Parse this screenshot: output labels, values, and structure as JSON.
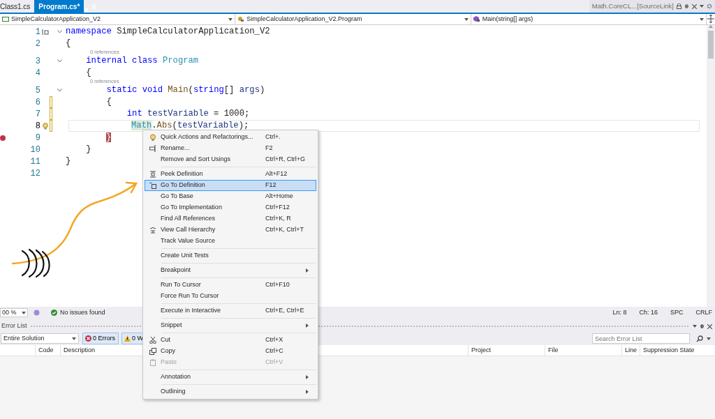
{
  "tabs": [
    {
      "label": "Class1.cs",
      "selected": false
    },
    {
      "label": "Program.cs*",
      "selected": true
    }
  ],
  "preview_tab": {
    "label": "Math.CoreCL...[SourceLink]"
  },
  "navigation": {
    "project": "SimpleCalculatorApplication_V2",
    "type": "SimpleCalculatorApplication_V2.Program",
    "member": "Main(string[] args)"
  },
  "code": {
    "lines": [
      {
        "number": "1",
        "collapsible": true,
        "changed": false,
        "breakpoint": false,
        "current": false,
        "lightbulb": false,
        "tokens": [
          {
            "text": "namespace",
            "kind": "keyword"
          },
          {
            "text": " SimpleCalculatorApplication_V2",
            "kind": "plain"
          }
        ]
      },
      {
        "number": "2",
        "collapsible": false,
        "changed": false,
        "breakpoint": false,
        "current": false,
        "lightbulb": false,
        "tokens": [
          {
            "text": "{",
            "kind": "plain"
          }
        ]
      },
      {
        "number": "3",
        "collapsible": true,
        "changed": false,
        "breakpoint": false,
        "current": false,
        "lightbulb": false,
        "codelens": "0 references",
        "tokens": [
          {
            "text": "    internal class",
            "kind": "keyword"
          },
          {
            "text": " Program",
            "kind": "type"
          }
        ]
      },
      {
        "number": "4",
        "collapsible": false,
        "changed": false,
        "breakpoint": false,
        "current": false,
        "lightbulb": false,
        "tokens": [
          {
            "text": "    {",
            "kind": "plain"
          }
        ]
      },
      {
        "number": "5",
        "collapsible": true,
        "changed": false,
        "breakpoint": false,
        "current": false,
        "lightbulb": false,
        "codelens": "0 references",
        "tokens": [
          {
            "text": "        static void",
            "kind": "keyword"
          },
          {
            "text": " Main",
            "kind": "method"
          },
          {
            "text": "(",
            "kind": "plain"
          },
          {
            "text": "string",
            "kind": "keyword"
          },
          {
            "text": "[] ",
            "kind": "plain"
          },
          {
            "text": "args",
            "kind": "variable"
          },
          {
            "text": ")",
            "kind": "plain"
          }
        ]
      },
      {
        "number": "6",
        "collapsible": false,
        "changed": true,
        "breakpoint": false,
        "current": false,
        "lightbulb": false,
        "tokens": [
          {
            "text": "        {",
            "kind": "plain"
          }
        ]
      },
      {
        "number": "7",
        "collapsible": false,
        "changed": true,
        "breakpoint": false,
        "current": false,
        "lightbulb": false,
        "tokens": [
          {
            "text": "            int",
            "kind": "keyword"
          },
          {
            "text": " testVariable",
            "kind": "variable"
          },
          {
            "text": " = 1000;",
            "kind": "plain"
          }
        ]
      },
      {
        "number": "8",
        "collapsible": false,
        "changed": true,
        "breakpoint": false,
        "current": true,
        "lightbulb": true,
        "tokens": [
          {
            "text": "Math",
            "kind": "reference"
          },
          {
            "text": ".",
            "kind": "plain"
          },
          {
            "text": "Abs",
            "kind": "method"
          },
          {
            "text": "(",
            "kind": "plain"
          },
          {
            "text": "testVariable",
            "kind": "variable"
          },
          {
            "text": ");",
            "kind": "plain"
          }
        ]
      },
      {
        "number": "9",
        "collapsible": false,
        "changed": false,
        "breakpoint": true,
        "current": false,
        "lightbulb": false,
        "tokens": [
          {
            "text": "}",
            "kind": "brace-stop"
          }
        ]
      },
      {
        "number": "10",
        "collapsible": false,
        "changed": false,
        "breakpoint": false,
        "current": false,
        "lightbulb": false,
        "tokens": [
          {
            "text": "    }",
            "kind": "plain"
          }
        ]
      },
      {
        "number": "11",
        "collapsible": false,
        "changed": false,
        "breakpoint": false,
        "current": false,
        "lightbulb": false,
        "tokens": [
          {
            "text": "}",
            "kind": "plain"
          }
        ]
      },
      {
        "number": "12",
        "collapsible": false,
        "changed": false,
        "breakpoint": false,
        "current": false,
        "lightbulb": false
      }
    ]
  },
  "context_menu": {
    "items": [
      {
        "kind": "command",
        "label": "Quick Actions and Refactorings...",
        "shortcut": "Ctrl+.",
        "selected": false
      },
      {
        "kind": "command",
        "label": "Rename...",
        "shortcut": "F2",
        "selected": false
      },
      {
        "kind": "command",
        "label": "Remove and Sort Usings",
        "shortcut": "Ctrl+R, Ctrl+G",
        "selected": false
      },
      {
        "kind": "separator"
      },
      {
        "kind": "command",
        "label": "Peek Definition",
        "shortcut": "Alt+F12",
        "selected": false
      },
      {
        "kind": "command",
        "label": "Go To Definition",
        "shortcut": "F12",
        "selected": true
      },
      {
        "kind": "command",
        "label": "Go To Base",
        "shortcut": "Alt+Home",
        "selected": false
      },
      {
        "kind": "command",
        "label": "Go To Implementation",
        "shortcut": "Ctrl+F12",
        "selected": false
      },
      {
        "kind": "command",
        "label": "Find All References",
        "shortcut": "Ctrl+K, R",
        "selected": false
      },
      {
        "kind": "command",
        "label": "View Call Hierarchy",
        "shortcut": "Ctrl+K, Ctrl+T",
        "selected": false
      },
      {
        "kind": "command",
        "label": "Track Value Source",
        "selected": false
      },
      {
        "kind": "separator"
      },
      {
        "kind": "command",
        "label": "Create Unit Tests",
        "selected": false
      },
      {
        "kind": "separator"
      },
      {
        "kind": "submenu",
        "label": "Breakpoint",
        "selected": false
      },
      {
        "kind": "separator"
      },
      {
        "kind": "command",
        "label": "Run To Cursor",
        "shortcut": "Ctrl+F10",
        "selected": false
      },
      {
        "kind": "command",
        "label": "Force Run To Cursor",
        "selected": false
      },
      {
        "kind": "separator"
      },
      {
        "kind": "command",
        "label": "Execute in Interactive",
        "shortcut": "Ctrl+E, Ctrl+E",
        "selected": false
      },
      {
        "kind": "separator"
      },
      {
        "kind": "submenu",
        "label": "Snippet",
        "selected": false
      },
      {
        "kind": "separator"
      },
      {
        "kind": "command",
        "label": "Cut",
        "shortcut": "Ctrl+X",
        "selected": false
      },
      {
        "kind": "command",
        "label": "Copy",
        "shortcut": "Ctrl+C",
        "selected": false
      },
      {
        "kind": "disabled",
        "label": "Paste",
        "shortcut": "Ctrl+V",
        "selected": false
      },
      {
        "kind": "separator"
      },
      {
        "kind": "submenu",
        "label": "Annotation",
        "selected": false
      },
      {
        "kind": "separator"
      },
      {
        "kind": "submenu",
        "label": "Outlining",
        "selected": false
      }
    ]
  },
  "status_bar": {
    "zoom": "00 %",
    "issues": "No issues found",
    "line": "Ln: 8",
    "column": "Ch: 16",
    "whitespace": "SPC",
    "line_ending": "CRLF"
  },
  "error_list": {
    "title": "Error List",
    "scope": "Entire Solution",
    "errors": "0 Errors",
    "warnings": "0 W",
    "search": {
      "placeholder": "Search Error List"
    },
    "columns": [
      "Code",
      "Description",
      "Project",
      "File",
      "Line",
      "Suppression State"
    ]
  }
}
